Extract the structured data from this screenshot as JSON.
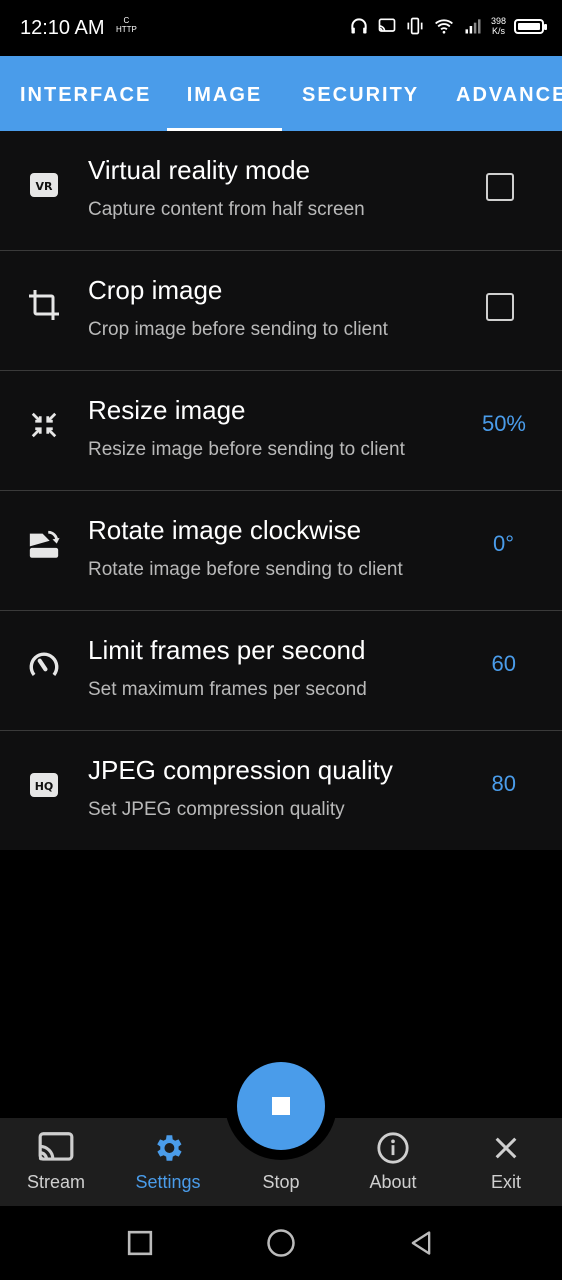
{
  "status_bar": {
    "time": "12:10 AM",
    "http_label": "HTTP",
    "speed_value": "398",
    "speed_unit": "K/s"
  },
  "tabs": [
    {
      "label": "INTERFACE",
      "active": false
    },
    {
      "label": "IMAGE",
      "active": true
    },
    {
      "label": "SECURITY",
      "active": false
    },
    {
      "label": "ADVANCED",
      "active": false
    }
  ],
  "settings": [
    {
      "icon": "vr-icon",
      "title": "Virtual reality mode",
      "subtitle": "Capture content from half screen",
      "control": "checkbox",
      "checked": false
    },
    {
      "icon": "crop-icon",
      "title": "Crop image",
      "subtitle": "Crop image before sending to client",
      "control": "checkbox",
      "checked": false
    },
    {
      "icon": "resize-icon",
      "title": "Resize image",
      "subtitle": "Resize image before sending to client",
      "value": "50%"
    },
    {
      "icon": "rotate-icon",
      "title": "Rotate image clockwise",
      "subtitle": "Rotate image before sending to client",
      "value": "0°"
    },
    {
      "icon": "speedometer-icon",
      "title": "Limit frames per second",
      "subtitle": "Set maximum frames per second",
      "value": "60"
    },
    {
      "icon": "hq-icon",
      "title": "JPEG compression quality",
      "subtitle": "Set JPEG compression quality",
      "value": "80"
    }
  ],
  "bottom_nav": [
    {
      "label": "Stream",
      "icon": "cast-icon",
      "active": false
    },
    {
      "label": "Settings",
      "icon": "gear-icon",
      "active": true
    },
    {
      "label": "Stop",
      "icon": "stop-icon",
      "active": false
    },
    {
      "label": "About",
      "icon": "info-icon",
      "active": false
    },
    {
      "label": "Exit",
      "icon": "close-icon",
      "active": false
    }
  ],
  "colors": {
    "accent": "#4a9cea",
    "background": "#000000",
    "row_background": "#0f0f10",
    "subtitle_text": "#b9b9b9"
  }
}
